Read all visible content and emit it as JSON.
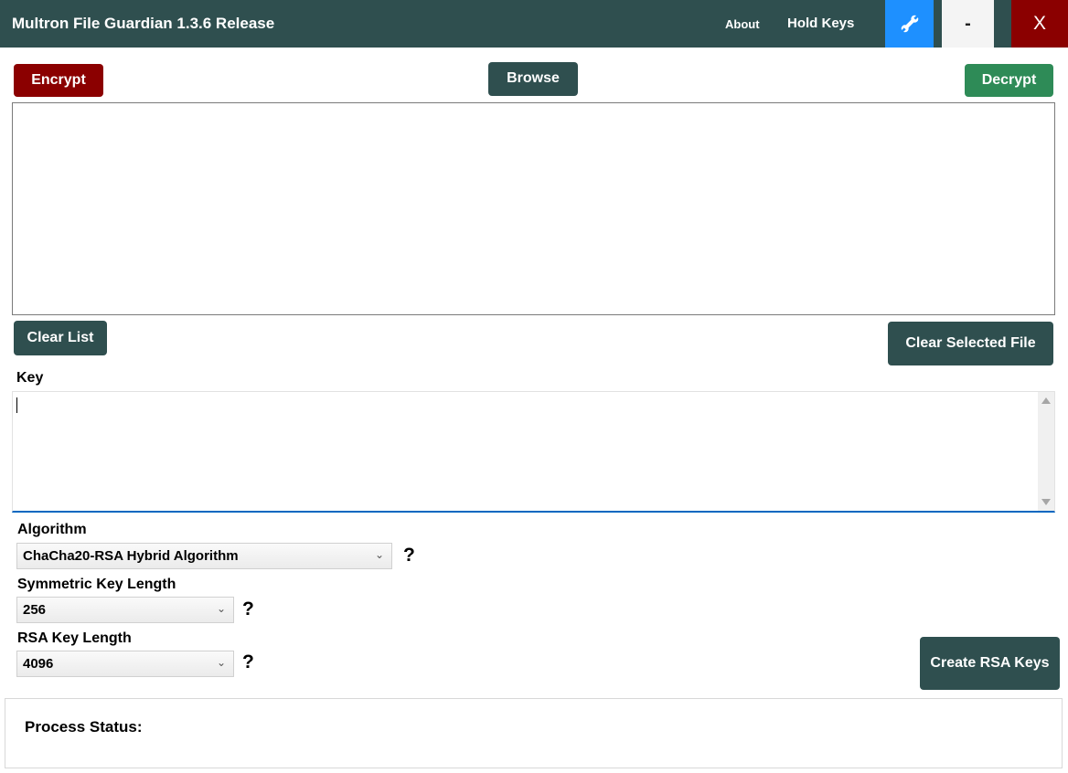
{
  "titlebar": {
    "title": "Multron File Guardian 1.3.6 Release",
    "about": "About",
    "hold_keys": "Hold Keys",
    "settings_icon": "wrench-icon",
    "minimize": "-",
    "close": "X"
  },
  "actions": {
    "encrypt": "Encrypt",
    "browse": "Browse",
    "decrypt": "Decrypt",
    "clear_list": "Clear List",
    "clear_selected": "Clear Selected File",
    "create_rsa": "Create RSA Keys"
  },
  "file_list": {
    "items": []
  },
  "key": {
    "label": "Key",
    "value": ""
  },
  "algorithm": {
    "label": "Algorithm",
    "selected": "ChaCha20-RSA Hybrid Algorithm",
    "help": "?"
  },
  "symmetric_key_length": {
    "label": "Symmetric Key Length",
    "selected": "256",
    "help": "?"
  },
  "rsa_key_length": {
    "label": "RSA Key Length",
    "selected": "4096",
    "help": "?"
  },
  "status": {
    "label": "Process Status:"
  },
  "colors": {
    "titlebar_bg": "#2f4f4f",
    "encrypt_bg": "#8b0000",
    "decrypt_bg": "#2e8b57",
    "accent_blue": "#1e90ff",
    "close_bg": "#8b0000"
  }
}
